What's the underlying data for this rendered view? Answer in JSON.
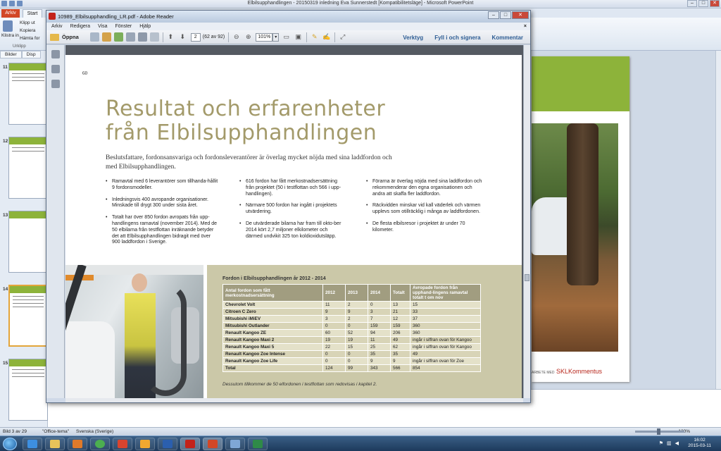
{
  "powerpoint": {
    "title": "Elbilsupphandlingen - 20150319 inledning Eva Sunnerstedt [Kompatibilitetsläge] - Microsoft PowerPoint",
    "tabs": {
      "file": "Arkiv",
      "home": "Start"
    },
    "ribbon": {
      "paste": "Klistra in",
      "cut": "Klipp ut",
      "copy": "Kopiera",
      "format_painter": "Hämta for",
      "group_label": "Urklipp"
    },
    "panel_tabs": {
      "slides": "Bilder",
      "outline": "Disp"
    },
    "slide_numbers": [
      "11",
      "12",
      "13",
      "14",
      "15"
    ],
    "slide_canvas": {
      "brand": "SKLKommentus",
      "brand_prefix": "ARBETE MED"
    },
    "status": {
      "slide": "Bild 3 av 29",
      "theme": "\"Office-tema\"",
      "language": "Svenska (Sverige)",
      "zoom": "120%"
    }
  },
  "taskbar": {
    "time": "16:02",
    "date": "2015-03-11"
  },
  "reader": {
    "title": "10989_Elbilsupphandling_LR.pdf - Adobe Reader",
    "menu": [
      "Arkiv",
      "Redigera",
      "Visa",
      "Fönster",
      "Hjälp"
    ],
    "toolbar": {
      "open": "Öppna",
      "page_value": "2",
      "page_of": "(62 av 92)",
      "zoom_value": "101%",
      "tools": "Verktyg",
      "fill_sign": "Fyll i och signera",
      "comment": "Kommentar"
    }
  },
  "pdf": {
    "page_number": "60",
    "heading_line1": "Resultat och erfarenheter",
    "heading_line2": "från Elbilsupphandlingen",
    "lead": "Beslutsfattare, fordonsansvariga och fordonsleverantörer är överlag mycket nöjda med sina laddfordon och med Elbilsupphandlingen.",
    "col1": [
      "Ramavtal med 6 leverantörer som tillhanda-hållit 9 fordonsmodeller.",
      "Inledningsvis 400 avropande organisationer. Minskade till drygt 300 under sista året.",
      "Totalt har över 850 fordon avropats från upp-handlingens ramavtal (november 2014). Med de 50 elbilarna från testflottan inräknande betyder det att Elbilsupphandlingen bidragit med över 900 laddfordon i Sverige."
    ],
    "col2": [
      "616 fordon har fått merkostnadsersättning från projektet (50 i testflottan och 566 i upp-handlingen).",
      "Närmare 500 fordon har ingått i projektets utvärdering.",
      "De utvärderade bilarna har fram till okto-ber 2014 kört 2,7 miljoner elkilometer och därmed undvikit 325 ton koldioxidutsläpp."
    ],
    "col3": [
      "Förarna är överlag nöjda med sina laddfordon och rekommenderar den egna organisationen och andra att skaffa fler laddfordon.",
      "Räckvidden minskar vid kall väderlek och värmen upplevs som otillräcklig i många av laddfordonen.",
      "De flesta elbilsresor i projektet är under 70 kilometer."
    ],
    "table_caption": "Fordon i Elbilsupphandlingen år 2012 - 2014",
    "table_headers": [
      "Antal fordon som fått merkostnadsersättning",
      "2012",
      "2013",
      "2014",
      "Totalt",
      "Avropade fordon från upphand-lingens ramavtal totalt t om nov"
    ],
    "table_rows": [
      [
        "Chevrolet Volt",
        "11",
        "2",
        "0",
        "13",
        "15"
      ],
      [
        "Citroen C Zero",
        "9",
        "9",
        "3",
        "21",
        "33"
      ],
      [
        "Mitsubishi iMiEV",
        "3",
        "2",
        "7",
        "12",
        "37"
      ],
      [
        "Mitsubishi Outlander",
        "0",
        "0",
        "159",
        "159",
        "360"
      ],
      [
        "Renault Kangoo ZE",
        "60",
        "52",
        "94",
        "206",
        "360"
      ],
      [
        "Renault Kangoo Maxi 2",
        "19",
        "19",
        "11",
        "49",
        "ingår i siffran ovan för Kangoo"
      ],
      [
        "Renault Kangoo Maxi 5",
        "22",
        "15",
        "25",
        "62",
        "ingår i siffran ovan för Kangoo"
      ],
      [
        "Renault Kangoo Zoe Intense",
        "0",
        "0",
        "35",
        "35",
        "49"
      ],
      [
        "Renault Kangoo Zoe Life",
        "0",
        "0",
        "9",
        "9",
        "ingår i siffran ovan för Zoe"
      ],
      [
        "Total",
        "124",
        "99",
        "343",
        "566",
        "854"
      ]
    ],
    "table_footnote": "Dessutom tillkommer de 50 elfordonen i testflottan som redovisas i kapitel 2."
  }
}
